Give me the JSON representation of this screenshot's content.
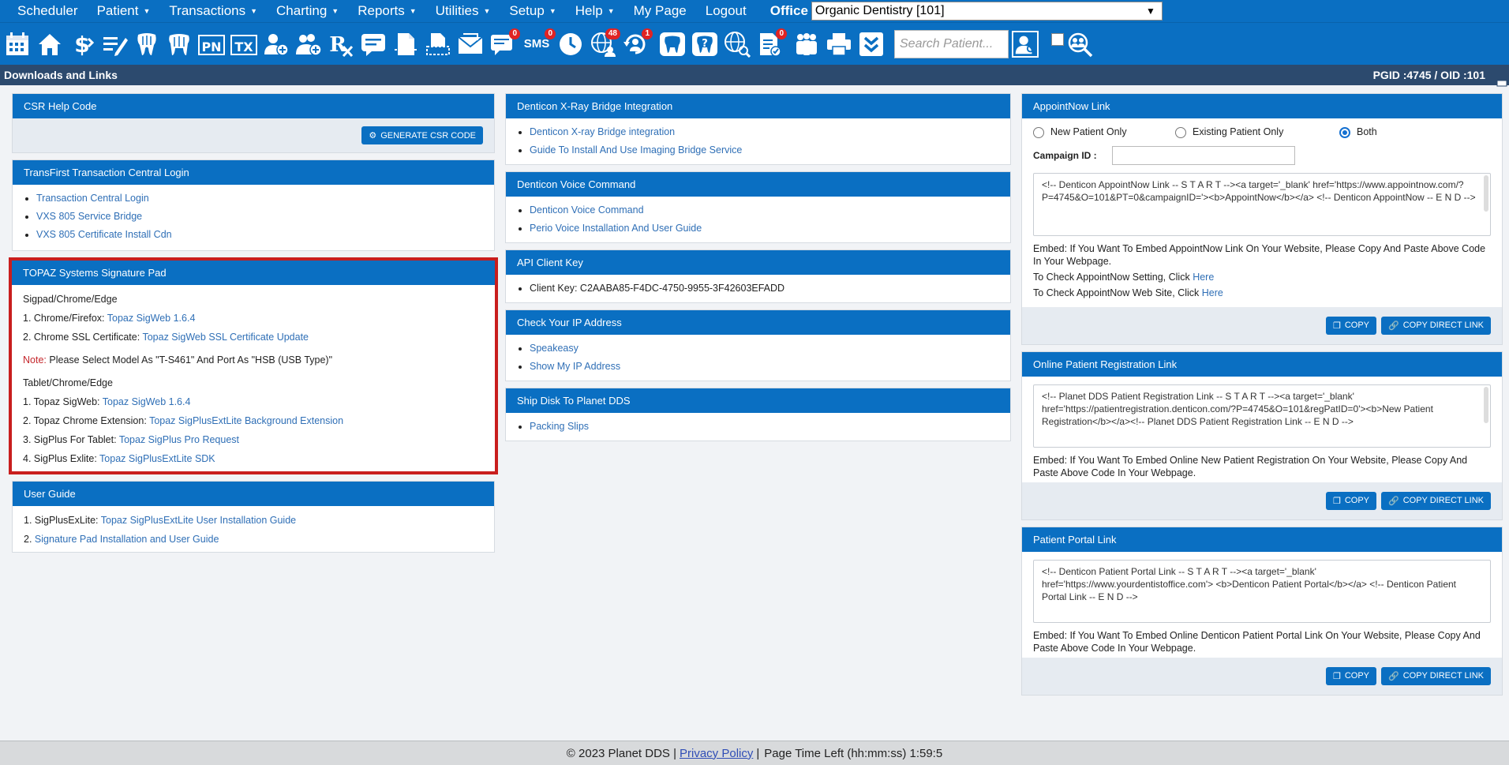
{
  "nav": {
    "items": [
      {
        "label": "Scheduler",
        "caret": false
      },
      {
        "label": "Patient",
        "caret": true
      },
      {
        "label": "Transactions",
        "caret": true
      },
      {
        "label": "Charting",
        "caret": true
      },
      {
        "label": "Reports",
        "caret": true
      },
      {
        "label": "Utilities",
        "caret": true
      },
      {
        "label": "Setup",
        "caret": true
      },
      {
        "label": "Help",
        "caret": true
      },
      {
        "label": "My Page",
        "caret": false
      },
      {
        "label": "Logout",
        "caret": false
      }
    ],
    "office_label": "Office",
    "office_value": "Organic Dentistry [101]"
  },
  "toolbar": {
    "badges": {
      "messages": "0",
      "sms": "0",
      "globe": "48",
      "recall": "1",
      "notes": "0"
    },
    "sms_label": "SMS",
    "pn_label": "PN",
    "tx_label": "TX",
    "search_placeholder": "Search Patient..."
  },
  "titlebar": {
    "title": "Downloads and Links",
    "ids": "PGID :4745  /  OID :101"
  },
  "csr": {
    "title": "CSR Help Code",
    "button": "GENERATE CSR CODE"
  },
  "transfirst": {
    "title": "TransFirst Transaction Central Login",
    "links": [
      "Transaction Central Login",
      "VXS 805 Service Bridge",
      "VXS 805 Certificate Install Cdn"
    ]
  },
  "topaz": {
    "title": "TOPAZ Systems Signature Pad",
    "section1": "Sigpad/Chrome/Edge",
    "item1_label": "1. Chrome/Firefox:",
    "item1_link": "Topaz SigWeb 1.6.4",
    "item2_label": "2. Chrome SSL Certificate:",
    "item2_link": "Topaz SigWeb SSL Certificate Update",
    "note_label": "Note:",
    "note_text": "Please Select Model As \"T-S461\" And Port As \"HSB (USB Type)\"",
    "section2": "Tablet/Chrome/Edge",
    "t1_label": "1. Topaz SigWeb:",
    "t1_link": "Topaz SigWeb 1.6.4",
    "t2_label": "2. Topaz Chrome Extension:",
    "t2_link": "Topaz SigPlusExtLite Background Extension",
    "t3_label": "3. SigPlus For Tablet:",
    "t3_link": "Topaz SigPlus Pro Request",
    "t4_label": "4. SigPlus Exlite:",
    "t4_link": "Topaz SigPlusExtLite SDK"
  },
  "userguide": {
    "title": "User Guide",
    "u1_label": "1. SigPlusExLite:",
    "u1_link": "Topaz SigPlusExtLite User Installation Guide",
    "u2_label": "2.",
    "u2_link": "Signature Pad Installation and User Guide"
  },
  "xray": {
    "title": "Denticon X-Ray Bridge Integration",
    "links": [
      "Denticon X-ray Bridge integration",
      "Guide To Install And Use Imaging Bridge Service"
    ]
  },
  "voice": {
    "title": "Denticon Voice Command",
    "links": [
      "Denticon Voice Command",
      "Perio Voice Installation And User Guide"
    ]
  },
  "api": {
    "title": "API Client Key",
    "key": "Client Key: C2AABA85-F4DC-4750-9955-3F42603EFADD"
  },
  "ip": {
    "title": "Check Your IP Address",
    "links": [
      "Speakeasy",
      "Show My IP Address"
    ]
  },
  "ship": {
    "title": "Ship Disk To Planet DDS",
    "links": [
      "Packing Slips"
    ]
  },
  "appointnow": {
    "title": "AppointNow Link",
    "radios": [
      "New Patient Only",
      "Existing Patient Only",
      "Both"
    ],
    "selected": "Both",
    "campaign_label": "Campaign ID :",
    "campaign_value": "",
    "code": "<!-- Denticon AppointNow Link --  S T A R T --><a target='_blank' href='https://www.appointnow.com/?P=4745&O=101&PT=0&campaignID='><b>AppointNow</b></a> <!-- Denticon AppointNow --  E N D -->",
    "embed": "Embed: If You Want To Embed AppointNow Link On Your Website, Please Copy And Paste Above Code In Your Webpage.",
    "check1_text": "To Check AppointNow Setting, Click",
    "check1_link": "Here",
    "check2_text": "To Check AppointNow Web Site, Click",
    "check2_link": "Here",
    "copy": "COPY",
    "copy_direct": "COPY DIRECT LINK"
  },
  "registration": {
    "title": "Online Patient Registration Link",
    "code": "<!-- Planet DDS Patient Registration Link --  S T A R T --><a target='_blank' href='https://patientregistration.denticon.com/?P=4745&O=101&regPatID=0'><b>New Patient Registration</b></a><!-- Planet DDS Patient Registration Link --  E N D -->",
    "embed": "Embed: If You Want To Embed Online New Patient Registration On Your Website, Please Copy And Paste Above Code In Your Webpage.",
    "copy": "COPY",
    "copy_direct": "COPY DIRECT LINK"
  },
  "portal": {
    "title": "Patient Portal Link",
    "code": "<!-- Denticon Patient Portal Link --  S T A R T --><a target='_blank' href='https://www.yourdentistoffice.com'> <b>Denticon Patient Portal</b></a> <!-- Denticon Patient Portal Link --  E N D -->",
    "embed": "Embed: If You Want To Embed Online Denticon Patient Portal Link On Your Website, Please Copy And Paste Above Code In Your Webpage.",
    "copy": "COPY",
    "copy_direct": "COPY DIRECT LINK"
  },
  "footer": {
    "copyright": "© 2023 Planet DDS |",
    "privacy": "Privacy Policy",
    "sep": "|",
    "time": "Page Time Left (hh:mm:ss) 1:59:5"
  }
}
